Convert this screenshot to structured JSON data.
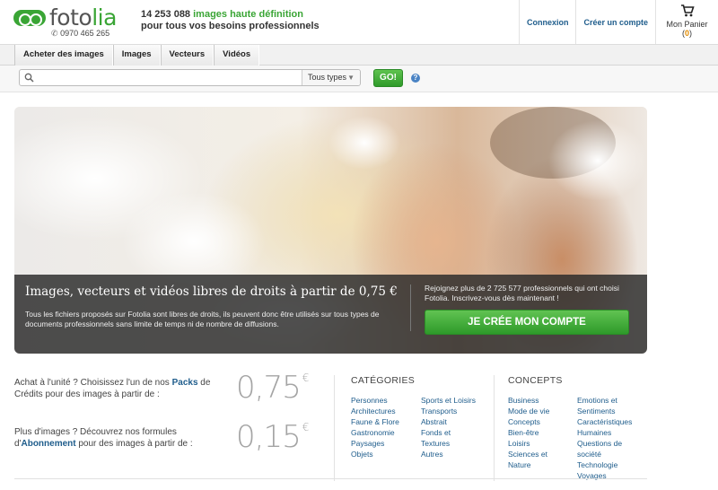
{
  "header": {
    "logo": {
      "part1": "foto",
      "part2": "lia"
    },
    "phone": "0970 465 265",
    "tagline": {
      "count": "14 253 088",
      "highlight": "images haute définition",
      "line2": "pour tous vos besoins professionnels"
    },
    "login_label": "Connexion",
    "create_account_label": "Créer un compte",
    "cart": {
      "label": "Mon Panier",
      "count_open": "(",
      "count": "0",
      "count_close": ")"
    }
  },
  "nav": {
    "items": [
      {
        "label": "Acheter des images"
      },
      {
        "label": "Images"
      },
      {
        "label": "Vecteurs"
      },
      {
        "label": "Vidéos"
      }
    ]
  },
  "search": {
    "placeholder": "",
    "value": "",
    "type_select": "Tous types",
    "go_label": "GO!",
    "help": "?"
  },
  "hero": {
    "title": "Images, vecteurs et vidéos libres de droits à partir de 0,75 €",
    "description": "Tous les fichiers proposés sur Fotolia sont libres de droits, ils peuvent donc être utilisés sur tous types de documents professionnels sans limite de temps ni de nombre de diffusions.",
    "join_text": "Rejoignez plus de 2 725 577 professionnels qui ont choisi Fotolia. Inscrivez-vous dès maintenant !",
    "cta_label": "JE CRÉE MON COMPTE"
  },
  "offers": {
    "packs": {
      "text_before": "Achat à l'unité ? Choisissez l'un de nos ",
      "link": "Packs",
      "text_after": " de Crédits pour des images à partir de :",
      "price": "0,75",
      "currency": "€"
    },
    "subscription": {
      "text_before": "Plus d'images ? Découvrez nos formules d'",
      "link": "Abonnement",
      "text_after": " pour des images à partir de :",
      "price": "0,15",
      "currency": "€"
    }
  },
  "categories": {
    "title": "CATÉGORIES",
    "col1": [
      "Personnes",
      "Architectures",
      "Faune & Flore",
      "Gastronomie",
      "Paysages",
      "Objets"
    ],
    "col2": [
      "Sports et Loisirs",
      "Transports",
      "Abstrait",
      "Fonds et",
      "Textures",
      "Autres"
    ]
  },
  "concepts": {
    "title": "CONCEPTS",
    "col1": [
      "Business",
      "Mode de vie",
      "Concepts",
      "Bien-être",
      "Loisirs",
      "Sciences et",
      "Nature"
    ],
    "col2": [
      "Emotions et",
      "Sentiments",
      "Caractéristiques",
      "Humaines",
      "Questions de",
      "société",
      "Technologie",
      "Voyages"
    ]
  },
  "colors": {
    "brand_green": "#3aa535",
    "link_blue": "#1f5d8c",
    "price_grey": "#a4a4a4"
  }
}
